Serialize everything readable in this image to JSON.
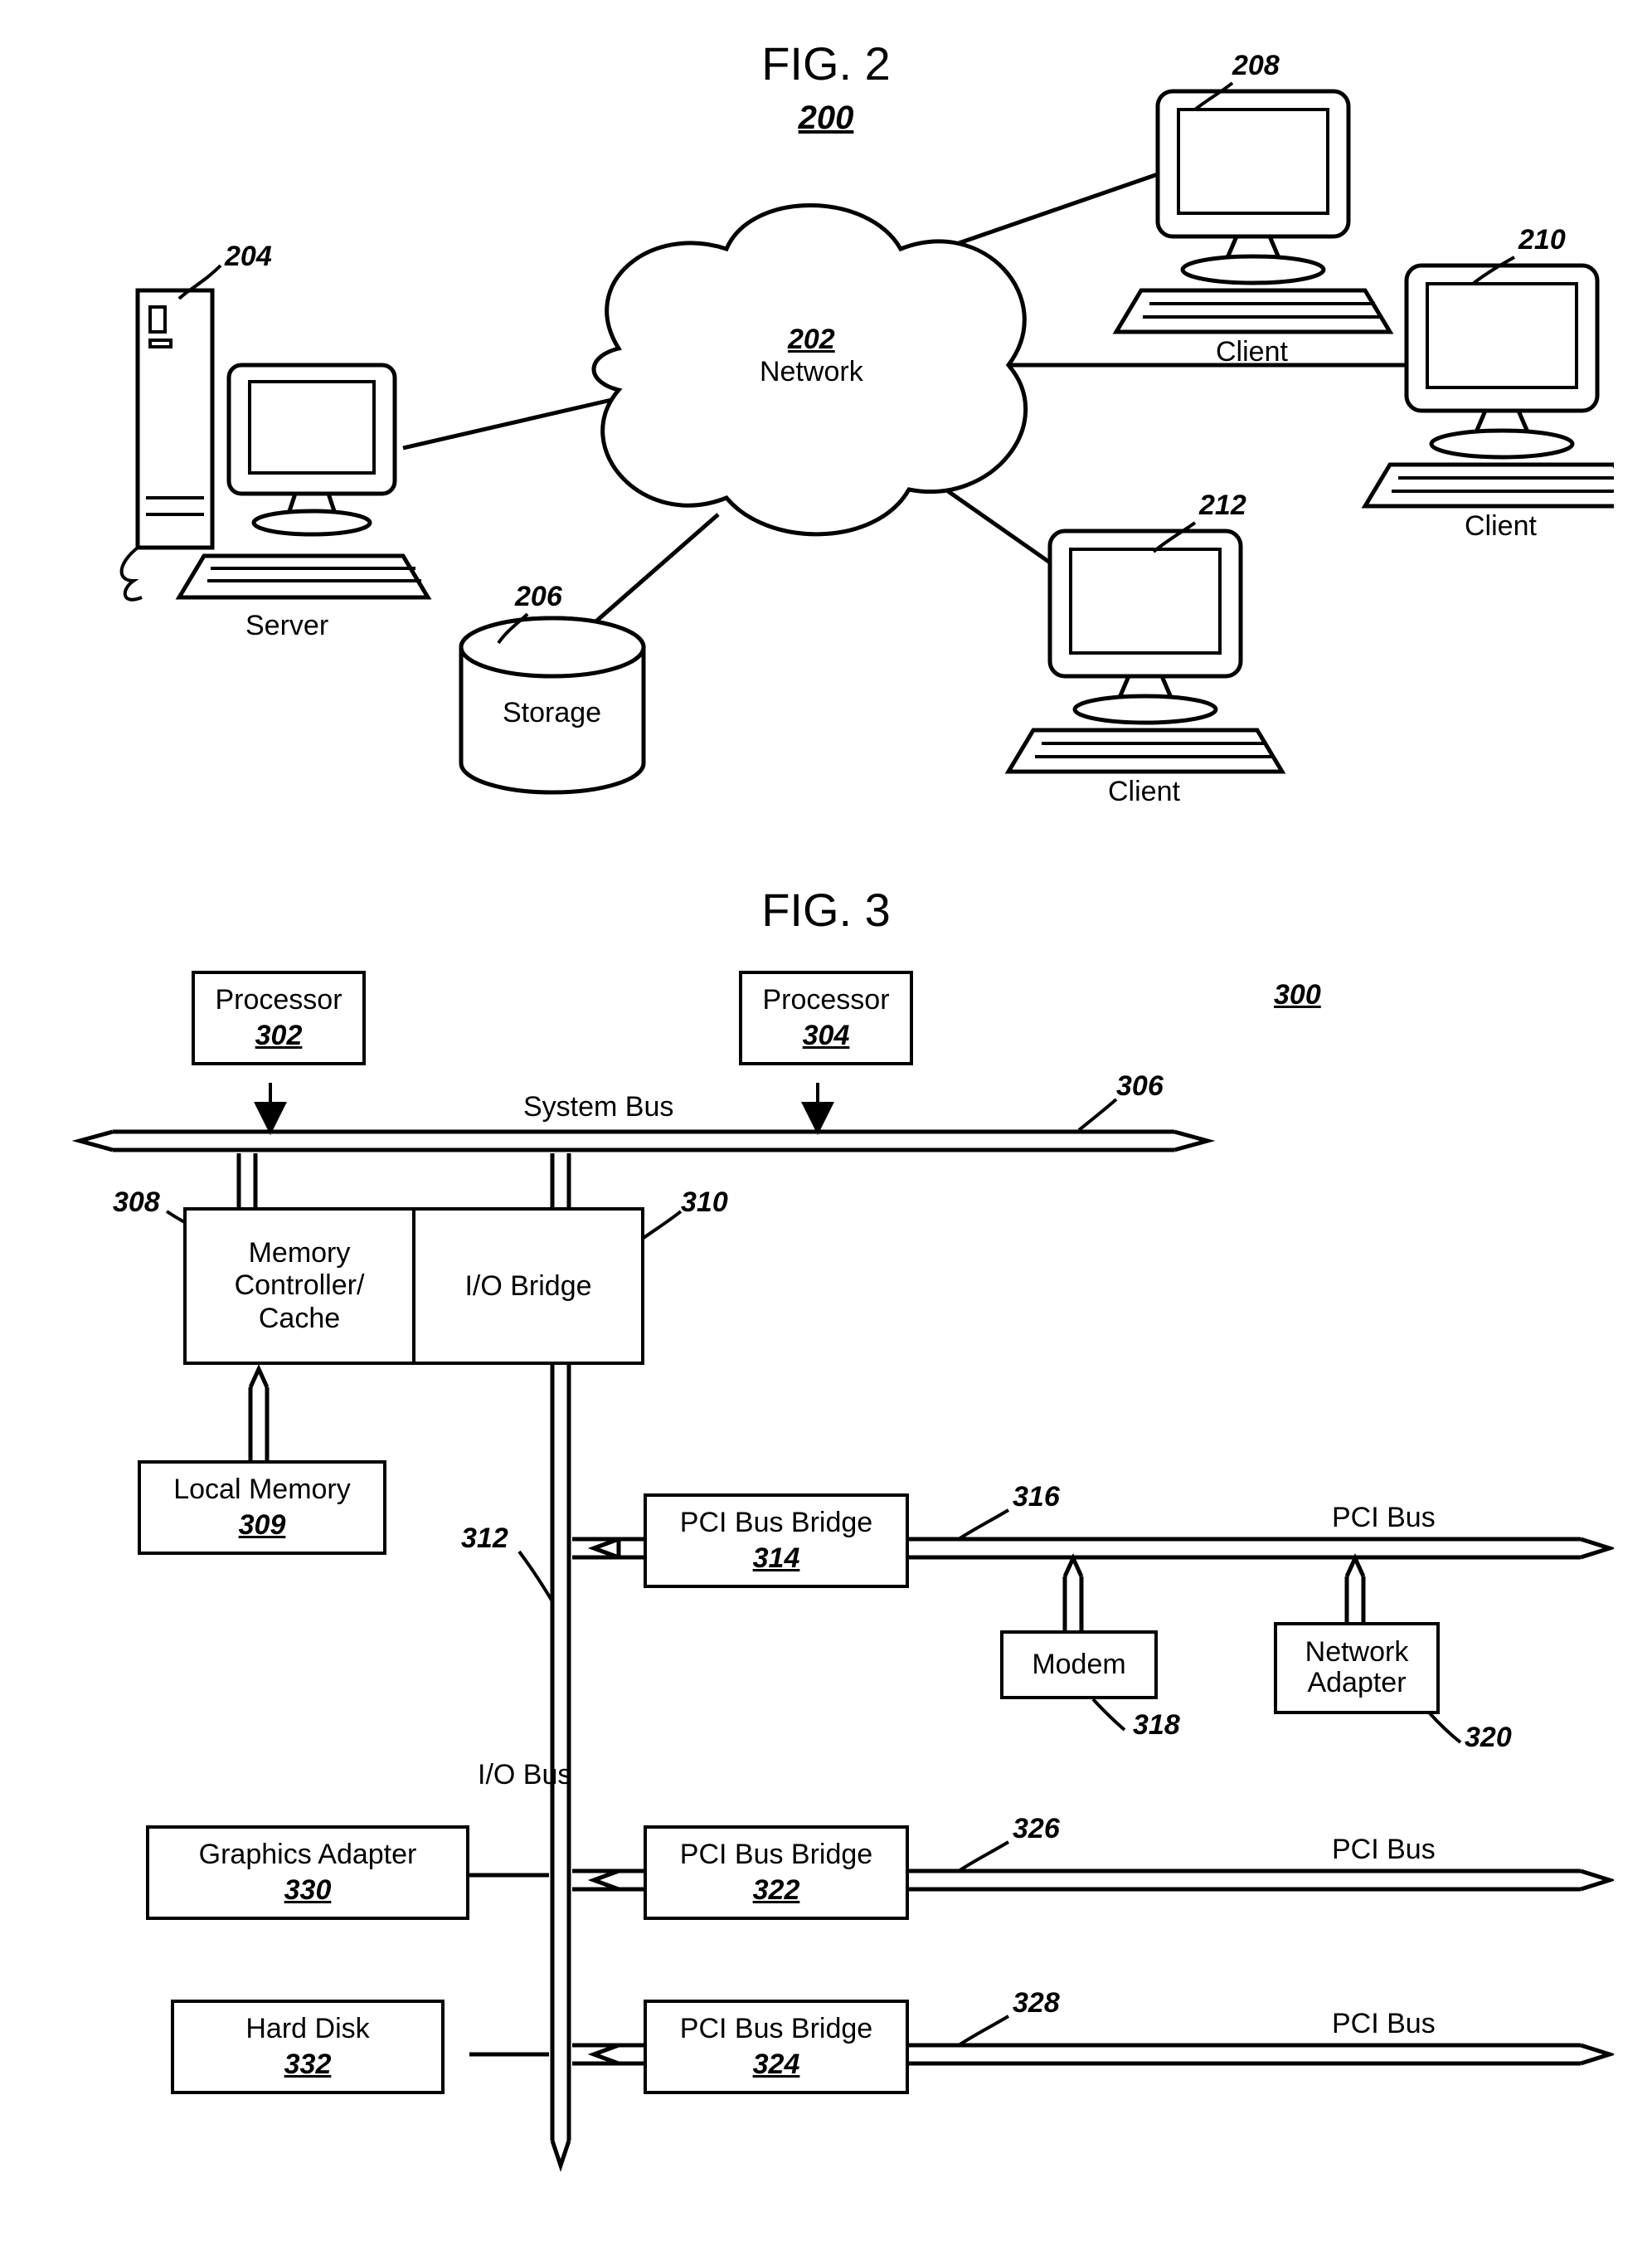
{
  "fig2": {
    "title": "FIG. 2",
    "num": "200",
    "network_num": "202",
    "network_label": "Network",
    "server_num": "204",
    "server_label": "Server",
    "storage_num": "206",
    "storage_label": "Storage",
    "client1_num": "208",
    "client1_label": "Client",
    "client2_num": "210",
    "client2_label": "Client",
    "client3_num": "212",
    "client3_label": "Client"
  },
  "fig3": {
    "title": "FIG. 3",
    "num": "300",
    "proc1_label": "Processor",
    "proc1_num": "302",
    "proc2_label": "Processor",
    "proc2_num": "304",
    "sysbus_label": "System Bus",
    "sysbus_num": "306",
    "memctrl_label": "Memory Controller/ Cache",
    "memctrl_num": "308",
    "localmem_label": "Local Memory",
    "localmem_num": "309",
    "iobridge_label": "I/O Bridge",
    "iobridge_num": "310",
    "iobus_label": "I/O Bus",
    "iobus_num": "312",
    "pcib1_label": "PCI Bus Bridge",
    "pcib1_num": "314",
    "pcibus1_label": "PCI Bus",
    "pcibus1_num": "316",
    "modem_label": "Modem",
    "modem_num": "318",
    "netadapter_label": "Network Adapter",
    "netadapter_num": "320",
    "pcib2_label": "PCI Bus Bridge",
    "pcib2_num": "322",
    "pcibus2_label": "PCI Bus",
    "pcibus2_num": "326",
    "pcib3_label": "PCI Bus Bridge",
    "pcib3_num": "324",
    "pcibus3_label": "PCI Bus",
    "pcibus3_num": "328",
    "graphics_label": "Graphics Adapter",
    "graphics_num": "330",
    "hdd_label": "Hard Disk",
    "hdd_num": "332"
  }
}
